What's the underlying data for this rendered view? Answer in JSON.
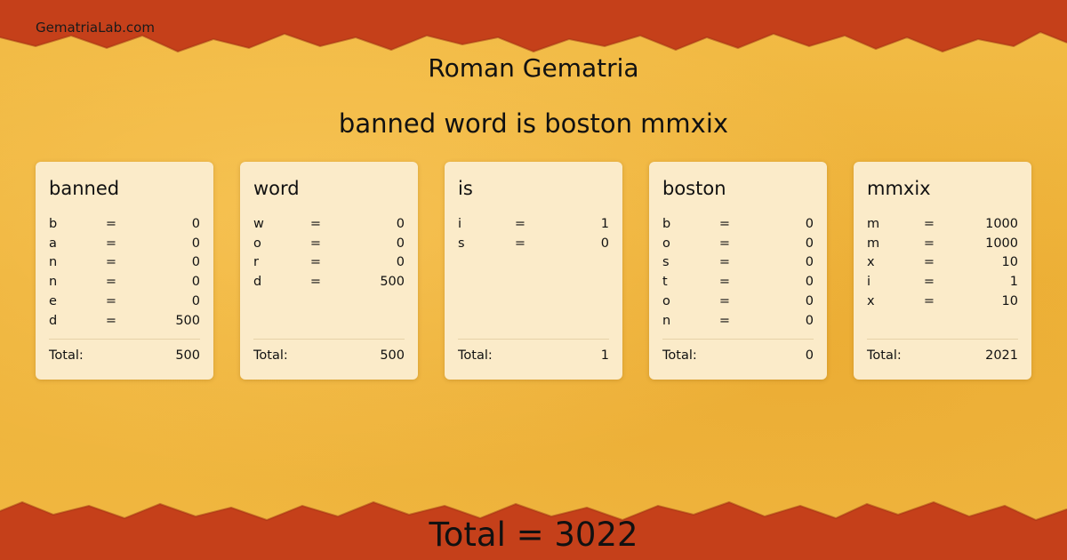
{
  "site": {
    "name": "GematriaLab.com"
  },
  "page": {
    "title": "Roman Gematria",
    "phrase": "banned word is boston mmxix",
    "grand_total": "Total = 3022"
  },
  "colors": {
    "background": "#efb53b",
    "band": "#c5401a",
    "card": "#fbebc9"
  },
  "cards": [
    {
      "word": "banned",
      "letters": [
        {
          "l": "b",
          "eq": "=",
          "v": "0"
        },
        {
          "l": "a",
          "eq": "=",
          "v": "0"
        },
        {
          "l": "n",
          "eq": "=",
          "v": "0"
        },
        {
          "l": "n",
          "eq": "=",
          "v": "0"
        },
        {
          "l": "e",
          "eq": "=",
          "v": "0"
        },
        {
          "l": "d",
          "eq": "=",
          "v": "500"
        }
      ],
      "total_label": "Total:",
      "total": "500"
    },
    {
      "word": "word",
      "letters": [
        {
          "l": "w",
          "eq": "=",
          "v": "0"
        },
        {
          "l": "o",
          "eq": "=",
          "v": "0"
        },
        {
          "l": "r",
          "eq": "=",
          "v": "0"
        },
        {
          "l": "d",
          "eq": "=",
          "v": "500"
        }
      ],
      "total_label": "Total:",
      "total": "500"
    },
    {
      "word": "is",
      "letters": [
        {
          "l": "i",
          "eq": "=",
          "v": "1"
        },
        {
          "l": "s",
          "eq": "=",
          "v": "0"
        }
      ],
      "total_label": "Total:",
      "total": "1"
    },
    {
      "word": "boston",
      "letters": [
        {
          "l": "b",
          "eq": "=",
          "v": "0"
        },
        {
          "l": "o",
          "eq": "=",
          "v": "0"
        },
        {
          "l": "s",
          "eq": "=",
          "v": "0"
        },
        {
          "l": "t",
          "eq": "=",
          "v": "0"
        },
        {
          "l": "o",
          "eq": "=",
          "v": "0"
        },
        {
          "l": "n",
          "eq": "=",
          "v": "0"
        }
      ],
      "total_label": "Total:",
      "total": "0"
    },
    {
      "word": "mmxix",
      "letters": [
        {
          "l": "m",
          "eq": "=",
          "v": "1000"
        },
        {
          "l": "m",
          "eq": "=",
          "v": "1000"
        },
        {
          "l": "x",
          "eq": "=",
          "v": "10"
        },
        {
          "l": "i",
          "eq": "=",
          "v": "1"
        },
        {
          "l": "x",
          "eq": "=",
          "v": "10"
        }
      ],
      "total_label": "Total:",
      "total": "2021"
    }
  ]
}
